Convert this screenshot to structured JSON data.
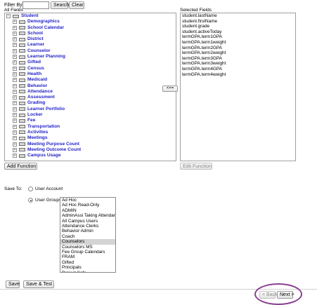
{
  "filter": {
    "label": "Filter By",
    "value": "",
    "search_label": "Search",
    "clear_label": "Clear"
  },
  "all_fields": {
    "title": "All Fields",
    "root_label": "Student",
    "items": [
      "Demographics",
      "School Calendar",
      "School",
      "District",
      "Learner",
      "Counselor",
      "Learner Planning",
      "Gifted",
      "Census",
      "Health",
      "Medicaid",
      "Behavior",
      "Attendance",
      "Assessment",
      "Grading",
      "Learner Portfolio",
      "Locker",
      "Fee",
      "Transportation",
      "Activities",
      "Meetings",
      "Meeting Purpose Count",
      "Meeting Outcome Count",
      "Campus Usage"
    ]
  },
  "move_left_label": "<==",
  "selected_fields": {
    "title": "Selected Fields",
    "items": [
      "student.lastName",
      "student.firstName",
      "student.grade",
      "student.activeToday",
      "termGPA.term1GPA",
      "termGPA.term1weight",
      "termGPA.term2GPA",
      "termGPA.term2weight",
      "termGPA.term3GPA",
      "termGPA.term3weight",
      "termGPA.term4GPA",
      "termGPA.term4weight"
    ]
  },
  "add_function_label": "Add Function",
  "edit_function_label": "Edit Function",
  "save_to": {
    "label": "Save To:",
    "user_account_label": "User Account",
    "user_groups_label": "User Groups",
    "selected_option": "User Groups",
    "groups": [
      "Ad Hoc",
      "Ad Hoc Read-Only",
      "ADMIN",
      "AdminAssi Taking Attendance",
      "All Campus Users",
      "Attendance Clerks",
      "Behavior Admin",
      "Coach",
      "Counselors",
      "Counselors MS",
      "Fee Group Calendars",
      "FRAM",
      "Gifted",
      "Principals",
      "Project Safe"
    ],
    "selected_group": "Counselors"
  },
  "footer": {
    "save_label": "Save",
    "save_test_label": "Save & Test",
    "back_label": "< Back",
    "next_label": "Next >"
  },
  "colors": {
    "tree_link": "#2424c8",
    "highlight_ring": "#8b3f91",
    "selected_row": "#d4d4d4"
  }
}
